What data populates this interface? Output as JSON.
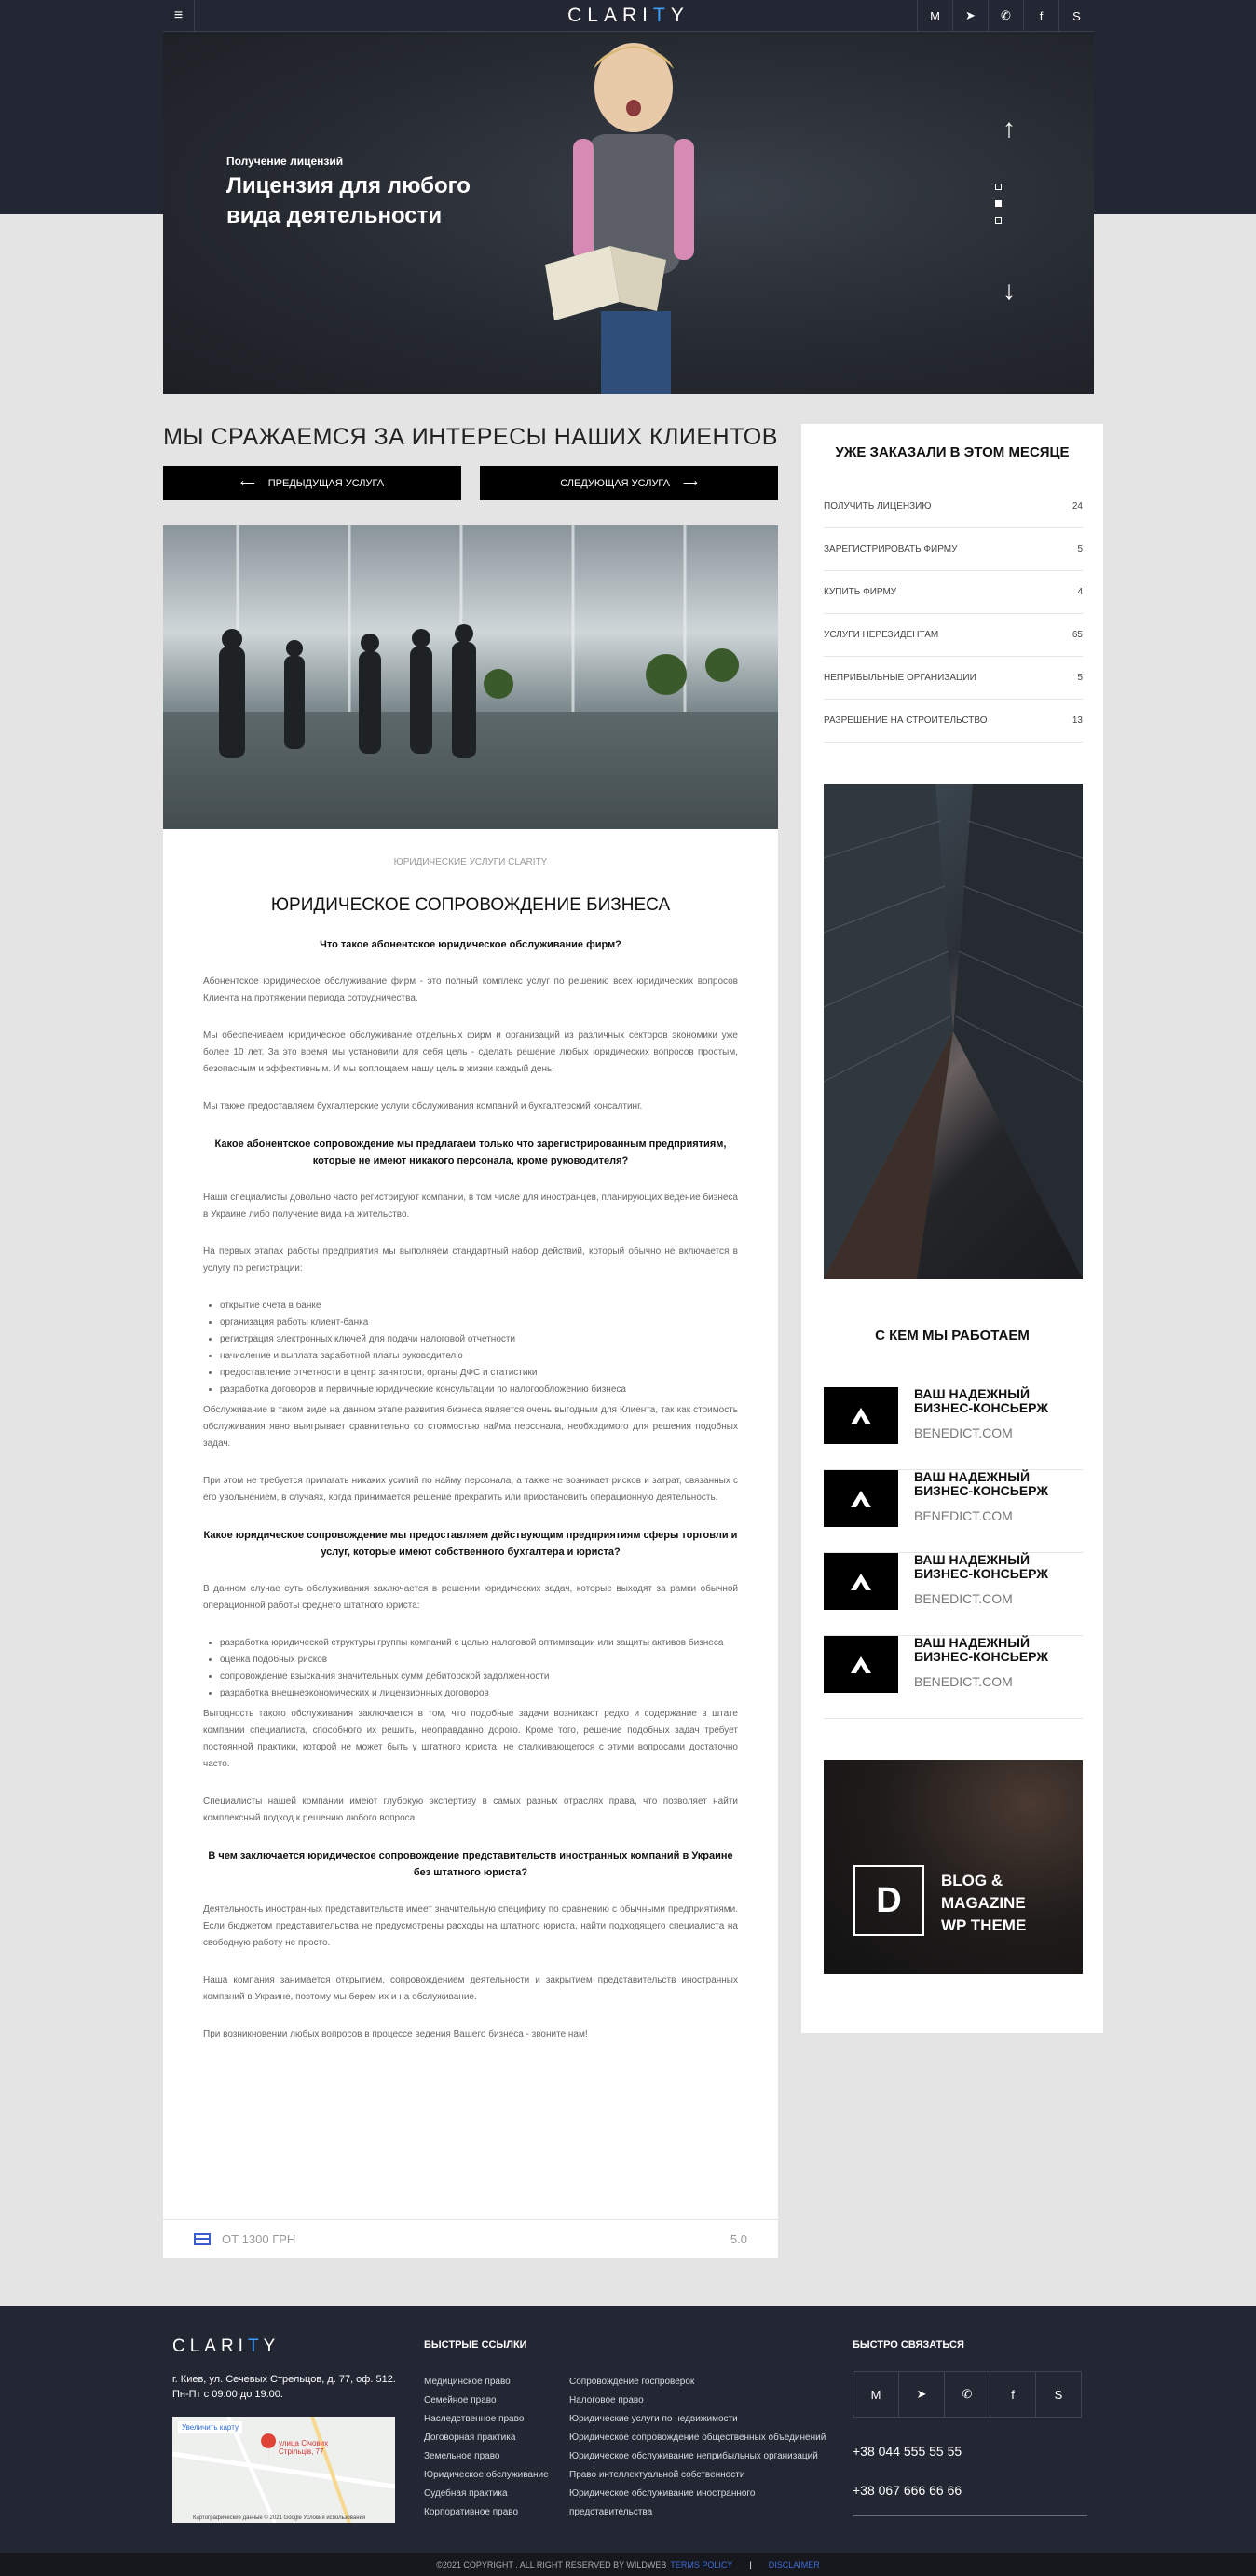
{
  "header": {
    "logo_prefix": "CLARI",
    "logo_dot": "T",
    "logo_suffix": "Y",
    "social": [
      "gmail-icon",
      "telegram-icon",
      "viber-icon",
      "facebook-icon",
      "skype-icon"
    ]
  },
  "hero": {
    "subtitle": "Получение лицензий",
    "title": "Лицензия для любого вида деятельности",
    "slides": 3,
    "active_slide": 2
  },
  "page": {
    "heading": "МЫ СРАЖАЕМСЯ ЗА ИНТЕРЕСЫ НАШИХ КЛИЕНТОВ",
    "prev": "ПРЕДЫДУЩАЯ УСЛУГА",
    "next": "СЛЕДУЮЩАЯ УСЛУГА"
  },
  "article": {
    "category": "ЮРИДИЧЕСКИЕ УСЛУГИ CLARITY",
    "title": "ЮРИДИЧЕСКОЕ СОПРОВОЖДЕНИЕ БИЗНЕСА",
    "q1": "Что такое абонентское юридическое обслуживание фирм?",
    "p1": "Абонентское юридическое обслуживание фирм - это полный комплекс услуг по решению всех юридических вопросов Клиента на протяжении периода сотрудничества.",
    "p2": "Мы обеспечиваем юридическое обслуживание отдельных фирм и организаций из различных секторов экономики уже более 10 лет. За это время мы установили для себя цель - сделать решение любых юридических вопросов простым, безопасным и эффективным. И мы воплощаем нашу цель в жизни каждый день.",
    "p3": "Мы также предоставляем бухгалтерские услуги обслуживания компаний и бухгалтерский консалтинг.",
    "q2": "Какое абонентское сопровождение мы предлагаем только что зарегистрированным предприятиям, которые не имеют никакого персонала, кроме руководителя?",
    "p4": "Наши специалисты довольно часто регистрируют компании, в том числе для иностранцев, планирующих ведение бизнеса в Украине либо получение вида на жительство.",
    "p5": "На первых этапах работы предприятия мы выполняем стандартный набор действий, который обычно не включается в услугу по регистрации:",
    "list1": [
      "открытие счета в банке",
      "организация работы клиент-банка",
      "регистрация электронных ключей для подачи налоговой отчетности",
      "начисление и выплата заработной платы руководителю",
      "предоставление отчетности в центр занятости, органы ДФС и статистики",
      "разработка договоров и первичные юридические консультации по налогообложению бизнеса"
    ],
    "p6": "Обслуживание в таком виде на данном этапе развития бизнеса является очень выгодным для Клиента, так как стоимость обслуживания явно выигрывает сравнительно со стоимостью найма персонала, необходимого для решения подобных задач.",
    "p7": "При этом не требуется прилагать никаких усилий по найму персонала, а также не возникает рисков и затрат, связанных с его увольнением, в случаях, когда принимается решение прекратить или приостановить операционную деятельность.",
    "q3": "Какое юридическое сопровождение мы предоставляем действующим предприятиям сферы торговли и услуг, которые имеют собственного бухгалтера и юриста?",
    "p8": "В данном случае суть обслуживания заключается в решении юридических задач, которые выходят за рамки обычной операционной работы среднего штатного юриста:",
    "list2": [
      "разработка юридической структуры группы компаний с целью налоговой оптимизации или защиты активов бизнеса",
      "оценка подобных рисков",
      "сопровождение взыскания значительных сумм дебиторской задолженности",
      "разработка внешнеэкономических и лицензионных договоров"
    ],
    "p9": "Выгодность такого обслуживания заключается в том, что подобные задачи возникают редко и содержание в штате компании специалиста, способного их решить, неоправданно дорого. Кроме того, решение подобных задач требует постоянной практики, которой не может быть у штатного юриста, не сталкивающегося с этими вопросами достаточно часто.",
    "p10": "Специалисты нашей компании имеют глубокую экспертизу в самых разных отраслях права, что позволяет найти комплексный подход к решению любого вопроса.",
    "q4": "В чем заключается юридическое сопровождение представительств иностранных компаний в Украине без штатного юриста?",
    "p11": "Деятельность иностранных представительств имеет значительную специфику по сравнению с обычными предприятиями. Если бюджетом представительства не предусмотрены расходы на штатного юриста, найти подходящего специалиста на свободную работу не просто.",
    "p12": "Наша компания занимается открытием, сопровождением деятельности и закрытием представительств иностранных компаний в Украине, поэтому мы берем их и на обслуживание.",
    "p13": "При возникновении любых вопросов в процессе ведения Вашего бизнеса - звоните нам!",
    "price": "ОТ 1300 ГРН",
    "rating": "5.0"
  },
  "sidebar": {
    "orders_title": "УЖЕ ЗАКАЗАЛИ В ЭТОМ МЕСЯЦЕ",
    "orders": [
      {
        "name": "ПОЛУЧИТЬ ЛИЦЕНЗИЮ",
        "count": "24"
      },
      {
        "name": "ЗАРЕГИСТРИРОВАТЬ ФИРМУ",
        "count": "5"
      },
      {
        "name": "КУПИТЬ ФИРМУ",
        "count": "4"
      },
      {
        "name": "УСЛУГИ НЕРЕЗИДЕНТАМ",
        "count": "65"
      },
      {
        "name": "НЕПРИБЫЛЬНЫЕ ОРГАНИЗАЦИИ",
        "count": "5"
      },
      {
        "name": "РАЗРЕШЕНИЕ НА СТРОИТЕЛЬСТВО",
        "count": "13"
      }
    ],
    "partners_title": "С КЕМ МЫ РАБОТАЕМ",
    "partners": [
      {
        "line1": "ВАШ НАДЕЖНЫЙ",
        "line2": "БИЗНЕС-КОНСЬЕРЖ",
        "url": "BENEDICT.COM"
      },
      {
        "line1": "ВАШ НАДЕЖНЫЙ",
        "line2": "БИЗНЕС-КОНСЬЕРЖ",
        "url": "BENEDICT.COM"
      },
      {
        "line1": "ВАШ НАДЕЖНЫЙ",
        "line2": "БИЗНЕС-КОНСЬЕРЖ",
        "url": "BENEDICT.COM"
      },
      {
        "line1": "ВАШ НАДЕЖНЫЙ",
        "line2": "БИЗНЕС-КОНСЬЕРЖ",
        "url": "BENEDICT.COM"
      }
    ],
    "ad_letter": "D",
    "ad_line1": "BLOG &",
    "ad_line2": "MAGAZINE",
    "ad_line3": "WP THEME"
  },
  "footer": {
    "logo_prefix": "CLARI",
    "logo_dot": "T",
    "logo_suffix": "Y",
    "address": "г. Киев, ул. Сечевых Стрельцов, д. 77, оф. 512.",
    "hours": "Пн-Пт с 09:00 до 19:00.",
    "map_button": "Увеличить карту",
    "map_pin": "улица Січових Стрільців, 77",
    "map_credit": "Картографические данные © 2021 Google   Условия использования",
    "links_title": "БЫСТРЫЕ ССЫЛКИ",
    "links_col1": [
      "Медицинское право",
      "Семейное право",
      "Наследственное право",
      "Договорная практика",
      "Земельное право",
      "Юридическое обслуживание",
      "Судебная практика",
      "Корпоративное право"
    ],
    "links_col2": [
      "Сопровождение госпроверок",
      "Налоговое право",
      "Юридические услуги по недвижимости",
      "Юридическое сопровождение общественных объединений",
      "Юридическое обслуживание неприбыльных организаций",
      "Право интеллектуальной собственности",
      "Юридическое обслуживание иностранного",
      "представительства"
    ],
    "contact_title": "БЫСТРО СВЯЗАТЬСЯ",
    "phone1": "+38 044 555 55 55",
    "phone2": "+38 067 666 66 66",
    "copyright": "©2021 COPYRIGHT . ALL RIGHT RESERVED BY WILDWEB",
    "terms": "TERMS POLICY",
    "divider": "|",
    "disclaimer": "DISCLAIMER"
  }
}
